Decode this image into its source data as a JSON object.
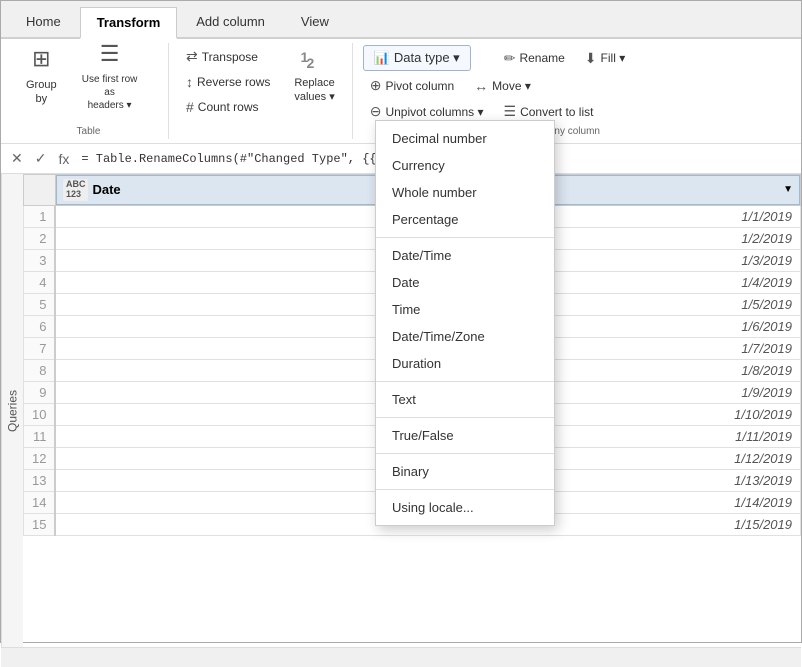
{
  "tabs": [
    {
      "label": "Home",
      "active": false
    },
    {
      "label": "Transform",
      "active": true
    },
    {
      "label": "Add column",
      "active": false
    },
    {
      "label": "View",
      "active": false
    }
  ],
  "ribbon": {
    "groups": [
      {
        "name": "Table",
        "buttons_large": [
          {
            "label": "Group\nby",
            "icon": "⊞"
          },
          {
            "label": "Use first row as\nheaders ▾",
            "icon": "☰"
          }
        ]
      },
      {
        "name": "",
        "buttons_small": [
          {
            "label": "Transpose",
            "icon": "⇄"
          },
          {
            "label": "Reverse rows",
            "icon": "↕"
          },
          {
            "label": "Count rows",
            "icon": "#"
          }
        ],
        "buttons_large": [
          {
            "label": "Replace\nvalues ▾",
            "icon": "12"
          }
        ]
      },
      {
        "name": "Any column",
        "datatype_label": "Data type ▾",
        "buttons_small": [
          {
            "label": "Rename",
            "icon": "✏"
          },
          {
            "label": "Pivot column",
            "icon": "⊕"
          },
          {
            "label": "Unpivot columns ▾",
            "icon": "⊖"
          },
          {
            "label": "Move ▾",
            "icon": "↔"
          },
          {
            "label": "Convert to list",
            "icon": "⬇"
          }
        ]
      }
    ]
  },
  "formula_bar": {
    "formula": "= Table.RenameColumns(#\"Changed Type\", {{\"Column1\", \"Date\"}})"
  },
  "sidebar_label": "Queries",
  "table": {
    "column": {
      "type_icon": "ABC\n123",
      "name": "Date",
      "has_dropdown": true
    },
    "rows": [
      {
        "num": 1,
        "value": "1/1/2019"
      },
      {
        "num": 2,
        "value": "1/2/2019"
      },
      {
        "num": 3,
        "value": "1/3/2019"
      },
      {
        "num": 4,
        "value": "1/4/2019"
      },
      {
        "num": 5,
        "value": "1/5/2019"
      },
      {
        "num": 6,
        "value": "1/6/2019"
      },
      {
        "num": 7,
        "value": "1/7/2019"
      },
      {
        "num": 8,
        "value": "1/8/2019"
      },
      {
        "num": 9,
        "value": "1/9/2019"
      },
      {
        "num": 10,
        "value": "1/10/2019"
      },
      {
        "num": 11,
        "value": "1/11/2019"
      },
      {
        "num": 12,
        "value": "1/12/2019"
      },
      {
        "num": 13,
        "value": "1/13/2019"
      },
      {
        "num": 14,
        "value": "1/14/2019"
      },
      {
        "num": 15,
        "value": "1/15/2019"
      }
    ]
  },
  "dropdown": {
    "items": [
      {
        "label": "Decimal number",
        "separator_after": false
      },
      {
        "label": "Currency",
        "separator_after": false
      },
      {
        "label": "Whole number",
        "separator_after": false
      },
      {
        "label": "Percentage",
        "separator_after": true
      },
      {
        "label": "Date/Time",
        "separator_after": false
      },
      {
        "label": "Date",
        "separator_after": false
      },
      {
        "label": "Time",
        "separator_after": false
      },
      {
        "label": "Date/Time/Zone",
        "separator_after": false
      },
      {
        "label": "Duration",
        "separator_after": true
      },
      {
        "label": "Text",
        "separator_after": true
      },
      {
        "label": "True/False",
        "separator_after": true
      },
      {
        "label": "Binary",
        "separator_after": true
      },
      {
        "label": "Using locale...",
        "separator_after": false
      }
    ]
  },
  "status_bar": {
    "text": ""
  }
}
